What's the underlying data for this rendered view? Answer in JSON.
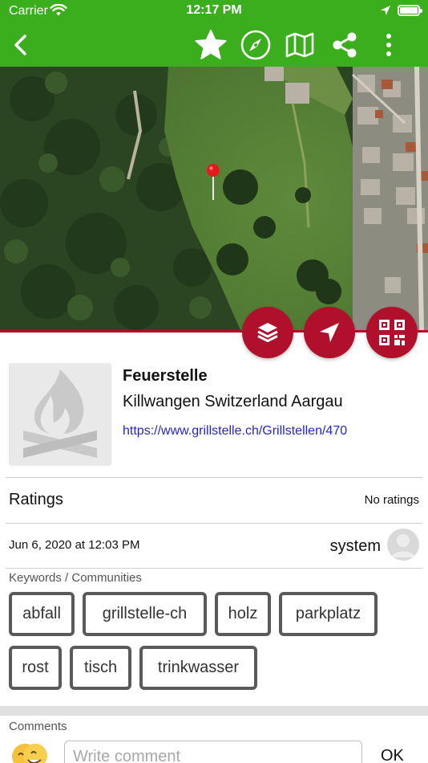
{
  "status_bar": {
    "carrier": "Carrier",
    "time": "12:17 PM",
    "battery_level": 1.0
  },
  "nav": {
    "back_icon": "chevron-left-icon",
    "actions": [
      "star-icon",
      "compass-icon",
      "map-icon",
      "share-icon",
      "more-vertical-icon"
    ]
  },
  "colors": {
    "nav_green": "#3aae1c",
    "accent_red": "#b0102b",
    "link_blue": "#2626c7"
  },
  "map": {
    "pin_icon": "map-pin-icon",
    "fabs": [
      "layers-icon",
      "navigate-icon",
      "qr-code-icon"
    ]
  },
  "place": {
    "title": "Feuerstelle",
    "location": "Killwangen Switzerland Aargau",
    "url": "https://www.grillstelle.ch/Grillstellen/470",
    "thumbnail_icon": "campfire-icon"
  },
  "ratings": {
    "label": "Ratings",
    "value": "No ratings"
  },
  "meta": {
    "date": "Jun 6, 2020 at 12:03 PM",
    "author": "system"
  },
  "keywords": {
    "label": "Keywords / Communities",
    "tags": [
      "abfall",
      "grillstelle-ch",
      "holz",
      "parkplatz",
      "rost",
      "tisch",
      "trinkwasser"
    ]
  },
  "comments": {
    "label": "Comments",
    "placeholder": "Write comment",
    "ok_label": "OK"
  }
}
